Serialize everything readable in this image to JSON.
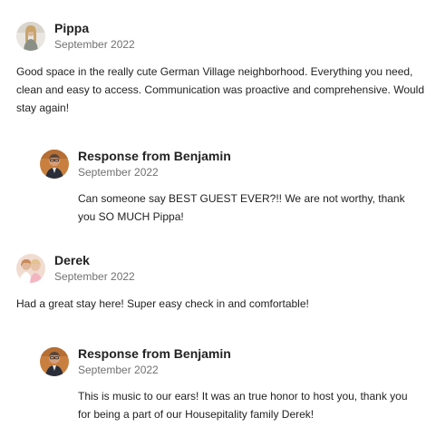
{
  "reviews": [
    {
      "name": "Pippa",
      "date": "September 2022",
      "avatar_icon": "person-avatar",
      "text": "Good space in the really cute German Village neighborhood. Everything you need, clean and easy to access. Communication was proactive and comprehensive. Would stay again!",
      "response": {
        "title": "Response from Benjamin",
        "date": "September 2022",
        "avatar_icon": "host-avatar",
        "text": "Can someone say BEST GUEST EVER?!! We are not worthy, thank you SO MUCH Pippa!"
      }
    },
    {
      "name": "Derek",
      "date": "September 2022",
      "avatar_icon": "person-avatar",
      "text": "Had a great stay here! Super easy check in and comfortable!",
      "response": {
        "title": "Response from Benjamin",
        "date": "September 2022",
        "avatar_icon": "host-avatar",
        "text": "This is music to our ears! It was an true honor to host you, thank you for being a part of our Housepitality family Derek!"
      }
    }
  ]
}
